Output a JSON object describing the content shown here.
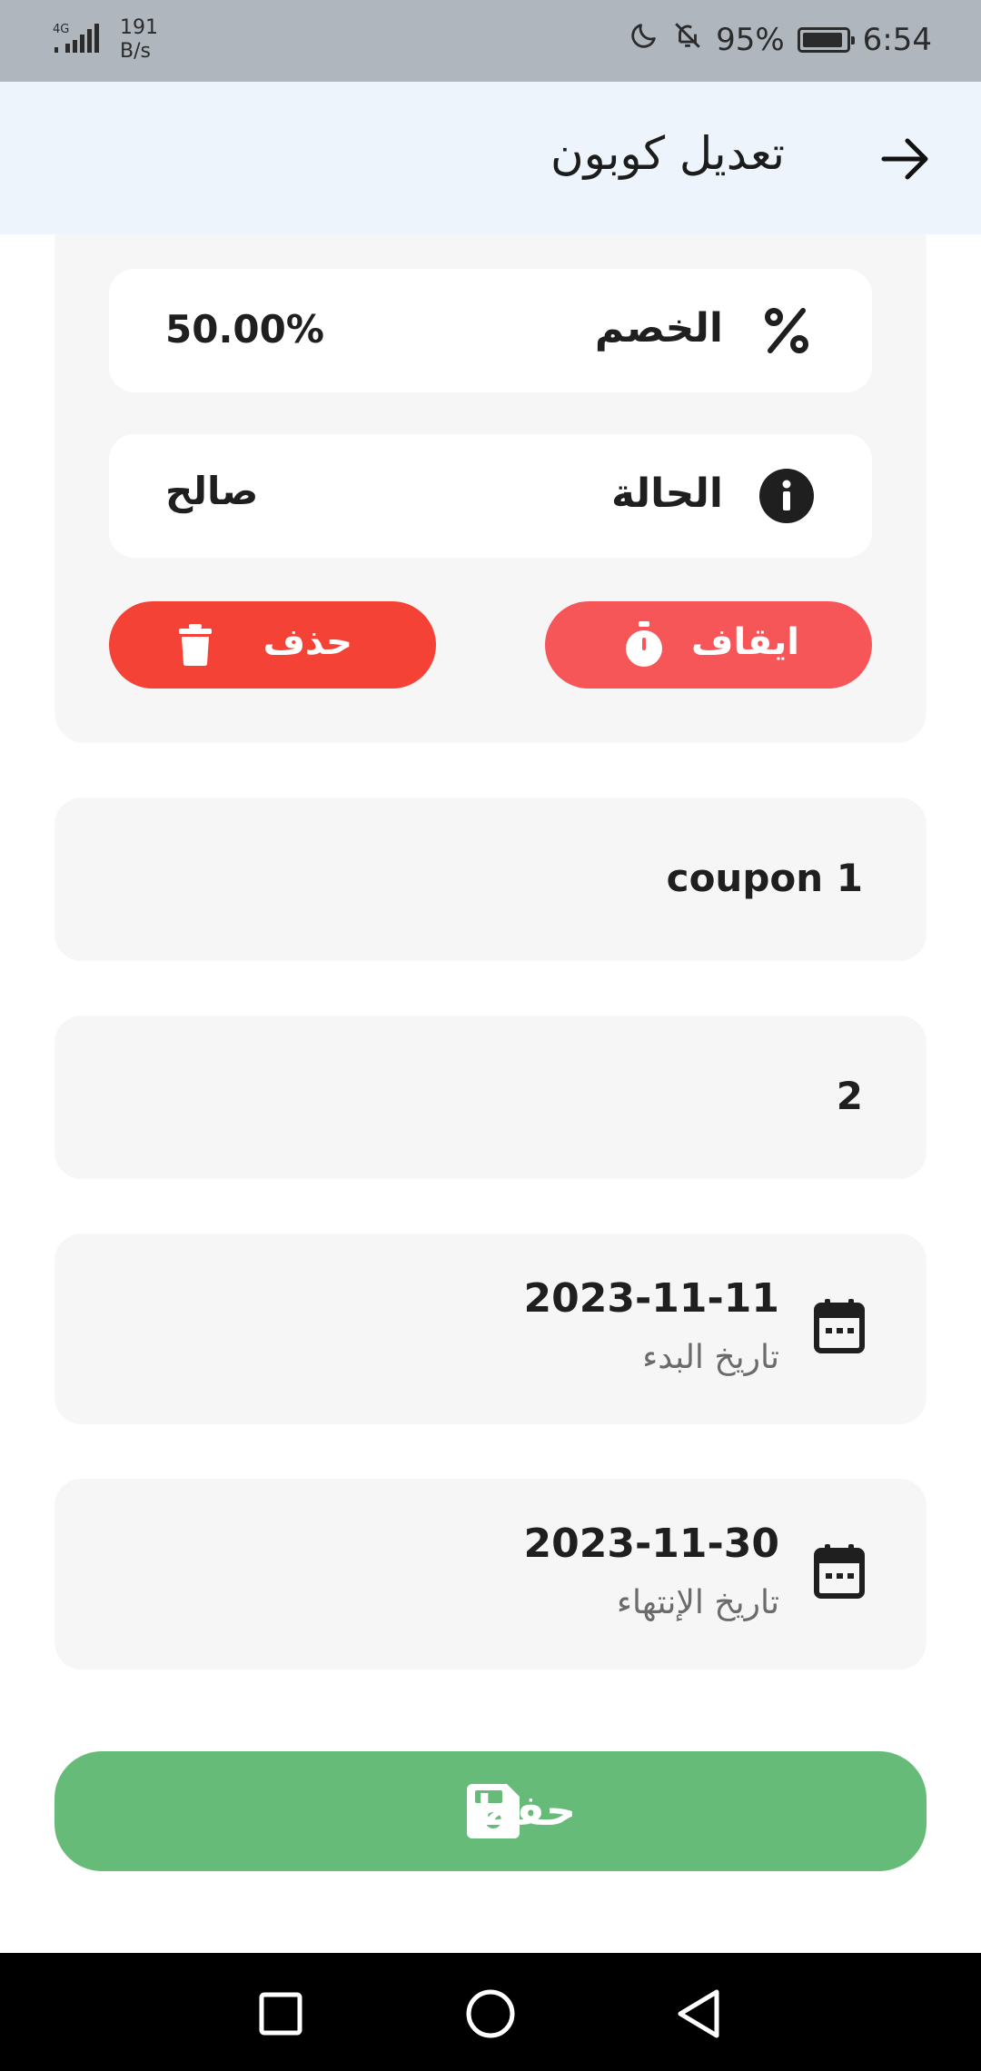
{
  "status_bar": {
    "network": "4G",
    "speed_value": "191",
    "speed_unit": "B/s",
    "battery": "95%",
    "battery_level": 0.95,
    "time": "6:54"
  },
  "app_bar": {
    "title": "تعديل كوبون",
    "back_icon": "arrow-right-icon"
  },
  "summary": {
    "discount_label": "الخصم",
    "discount_value": "50.00%",
    "status_label": "الحالة",
    "status_value": "صالح",
    "stop_label": "ايقاف",
    "delete_label": "حذف"
  },
  "form": {
    "code": "coupon 1",
    "usage_count": "2",
    "start_date": {
      "value": "2023-11-11",
      "label": "تاريخ البدء"
    },
    "end_date": {
      "value": "2023-11-30",
      "label": "تاريخ الإنتهاء"
    }
  },
  "save_label": "حفظ",
  "colors": {
    "status_bar": "#afb6bd",
    "app_bar": "#eef4fb",
    "card": "#f6f6f6",
    "stop": "#f65658",
    "delete": "#f44336",
    "save": "#66bb79"
  }
}
